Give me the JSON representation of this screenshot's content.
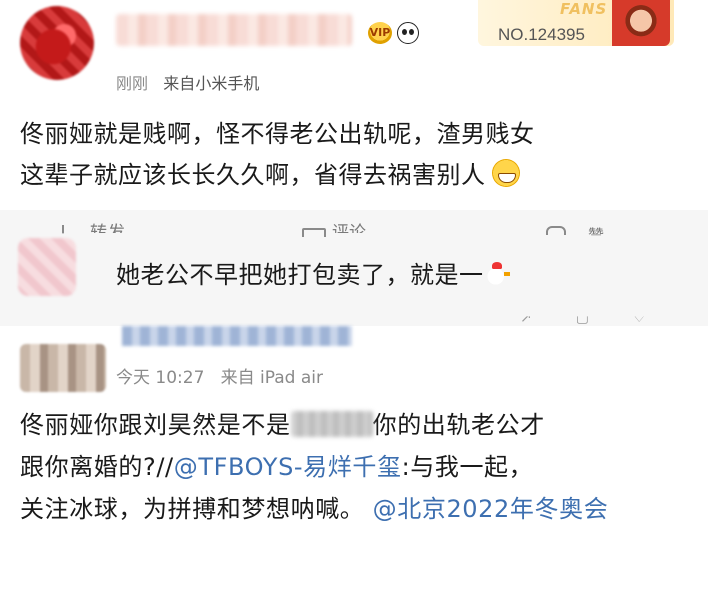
{
  "post1": {
    "fans_label": "FANS",
    "fans_number": "NO.124395",
    "vip_badge": "VIP",
    "time": "刚刚",
    "source_prefix": "来自",
    "source": "小米手机",
    "content_line1": "佟丽娅就是贱啊，怪不得老公出轨呢，渣男贱女",
    "content_line2": "这辈子就应该长长久久啊，省得去祸害别人",
    "emoji_icon": "grinning-face-icon"
  },
  "action_row": {
    "share_label": "转发",
    "comment_label": "评论",
    "like_label": "赞"
  },
  "post2": {
    "comment": "她老公不早把她打包卖了，就是一",
    "emoji_icon": "chicken-icon"
  },
  "post3": {
    "time": "今天 10:27",
    "source_prefix": "来自",
    "source": "iPad air",
    "content_a": "佟丽娅你跟刘昊然是不是",
    "content_b": "你的出轨老公才",
    "content_c": "跟你离婚的?//",
    "mention1": "@TFBOYS-易烊千玺",
    "content_d": ":与我一起，",
    "content_e": "关注冰球，为拼搏和梦想呐喊。 ",
    "mention2": "@北京2022年冬奥会"
  }
}
